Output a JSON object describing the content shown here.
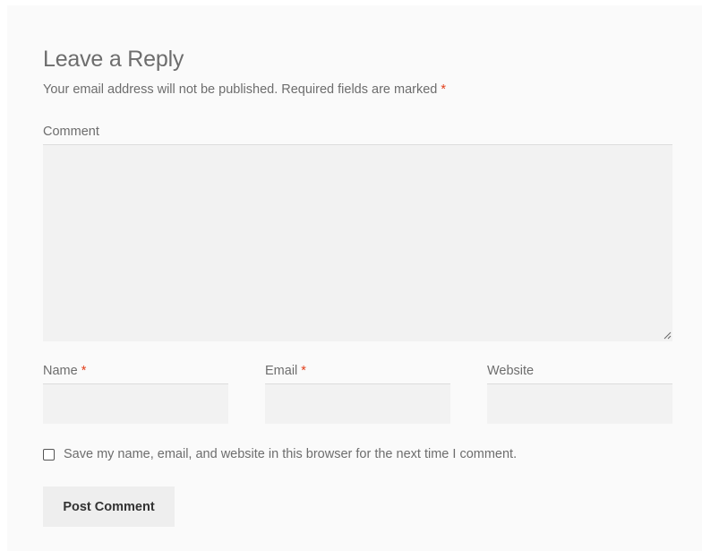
{
  "reply": {
    "title": "Leave a Reply",
    "notes": "Your email address will not be published. Required fields are marked",
    "required_mark": "*"
  },
  "fields": {
    "comment_label": "Comment",
    "name_label": "Name",
    "email_label": "Email",
    "website_label": "Website"
  },
  "cookies_consent": {
    "label": "Save my name, email, and website in this browser for the next time I comment.",
    "checked": false
  },
  "submit": {
    "label": "Post Comment"
  },
  "colors": {
    "panel_bg": "#fafafa",
    "field_bg": "#f2f2f2",
    "required": "#e2401c",
    "button_bg": "#eeeeee"
  }
}
